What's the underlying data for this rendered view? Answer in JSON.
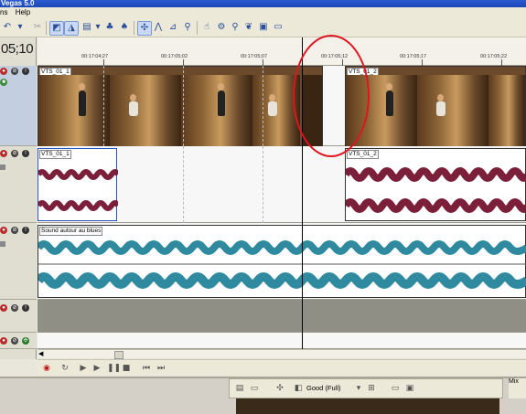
{
  "window": {
    "title": "Vegas 5.0"
  },
  "menu": [
    "ns",
    "Help"
  ],
  "timecode": "05;10",
  "ruler": {
    "labels": [
      "00:17:04;27",
      "00:17:05;02",
      "00:17:05;07",
      "00:17:05;12",
      "00:17:05;17",
      "00:17:05;22"
    ]
  },
  "tracks": {
    "video_clip_1": "VTS_01_1",
    "video_clip_2": "VTS_01_2",
    "audio_clip_1": "VTS_01_1",
    "audio_clip_2": "VTS_01_2",
    "music_clip": "Sound autour au blues"
  },
  "preview": {
    "quality": "Good (Full)",
    "mixer_label": "Mix"
  },
  "colors": {
    "audio_wave": "#7b1f3a",
    "music_wave": "#2f8aa0",
    "annotation": "#e0141f"
  }
}
